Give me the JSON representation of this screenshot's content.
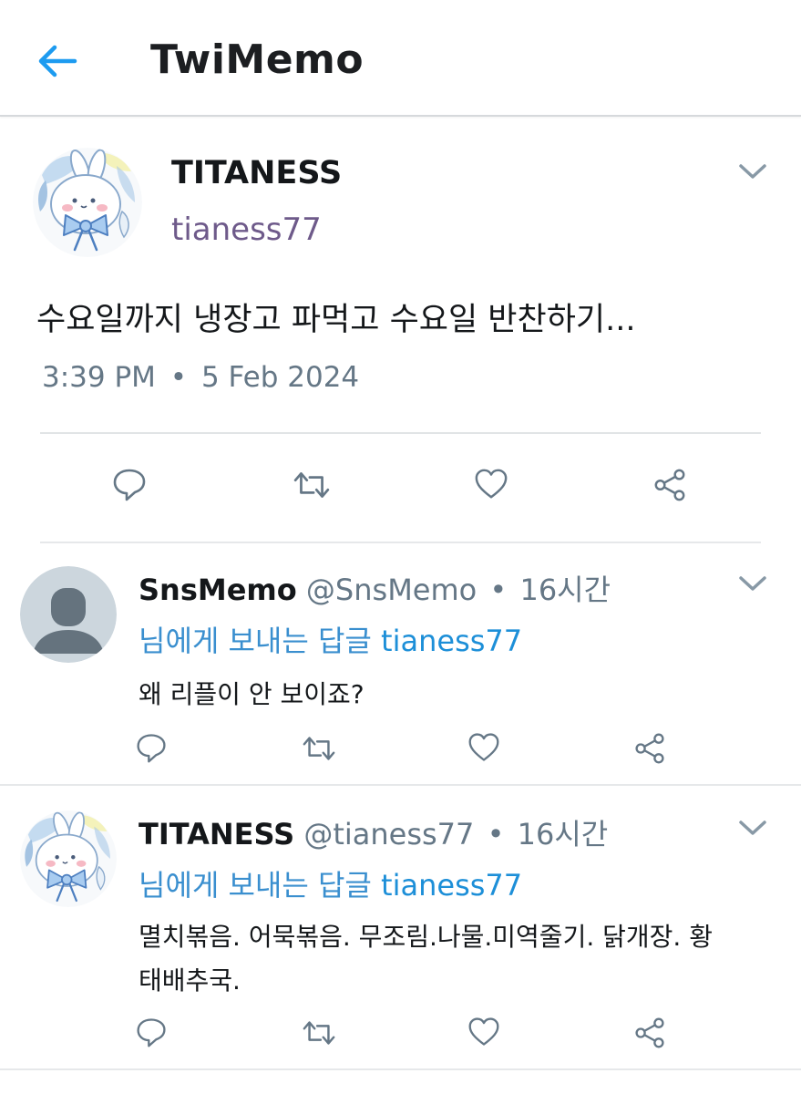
{
  "app": {
    "title": "TwiMemo"
  },
  "main_tweet": {
    "name": "TITANESS",
    "handle": "tianess77",
    "text": "수요일까지 냉장고 파먹고 수요일 반찬하기...",
    "time": "3:39 PM",
    "separator": "•",
    "date": "5 Feb 2024"
  },
  "replies": [
    {
      "name": "SnsMemo",
      "handle": "@SnsMemo",
      "separator": "•",
      "age": "16시간",
      "reply_label": "님에게 보내는 답글",
      "reply_to": "tianess77",
      "text": "왜 리플이 안 보이죠?",
      "avatar": "default-user-icon"
    },
    {
      "name": "TITANESS",
      "handle": "@tianess77",
      "separator": "•",
      "age": "16시간",
      "reply_label": "님에게 보내는 답글",
      "reply_to": "tianess77",
      "text_line1": "멸치볶음. 어묵볶음. 무조림.나물.미역줄기. 닭개장. 황",
      "text_line2": "태배추국.",
      "avatar": "bunny-illustration"
    }
  ],
  "icons": [
    "back-arrow-icon",
    "chevron-down-icon",
    "reply-icon",
    "retweet-icon",
    "like-icon",
    "share-icon"
  ],
  "colors": {
    "accent": "#1d9bf0",
    "icon": "#657786",
    "handle": "#6e5a8a"
  }
}
